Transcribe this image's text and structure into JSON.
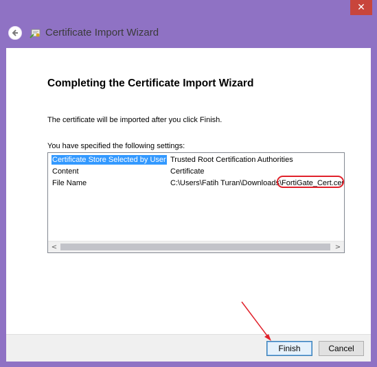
{
  "window": {
    "title": "Certificate Import Wizard",
    "close_glyph": "✕",
    "accent_color": "#8f72c4",
    "close_color": "#c8453b"
  },
  "icons": {
    "back": "back-arrow-icon",
    "wizard": "certificate-wizard-icon"
  },
  "content": {
    "heading": "Completing the Certificate Import Wizard",
    "description": "The certificate will be imported after you click Finish.",
    "settings_label": "You have specified the following settings:",
    "settings": [
      {
        "name": "Certificate Store Selected by User",
        "value": "Trusted Root Certification Authorities",
        "selected": true
      },
      {
        "name": "Content",
        "value": "Certificate",
        "selected": false
      },
      {
        "name": "File Name",
        "value": "C:\\Users\\Fatih Turan\\Downloads\\FortiGate_Cert.cer",
        "selected": false
      }
    ],
    "filename_prefix": "C:\\Users\\Fatih Turan\\Downloads\\",
    "filename_highlight": "FortiGate_Cert.cer",
    "highlight_color": "#e0202a"
  },
  "footer": {
    "finish_label": "Finish",
    "cancel_label": "Cancel"
  },
  "scroll": {
    "left_glyph": "<",
    "right_glyph": ">"
  }
}
